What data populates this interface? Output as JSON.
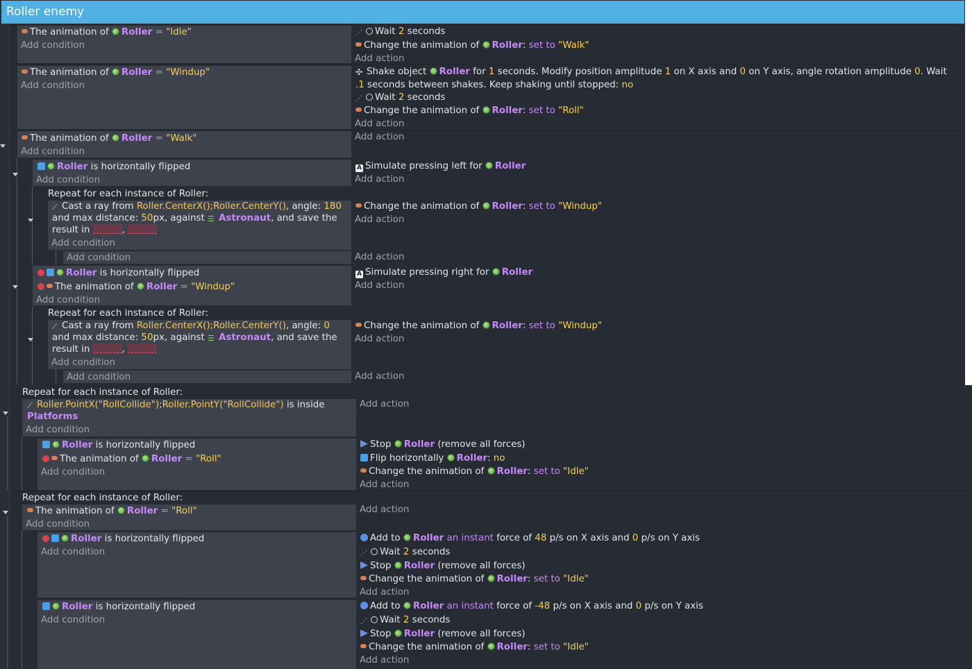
{
  "group": {
    "title": "Roller enemy"
  },
  "obj": "Roller",
  "astro": "Astronaut",
  "platforms": "Platforms",
  "add_condition": "Add condition",
  "add_action": "Add action",
  "words": {
    "anim_of": "The animation of",
    "eq": "=",
    "is_hflipped": "is horizontally flipped",
    "repeat": "Repeat for each instance of Roller:",
    "wait": "Wait",
    "seconds": "seconds",
    "change_anim": "Change the animation of",
    "set_to": "set to",
    "colon": ":",
    "stop": "Stop",
    "remove_forces": "(remove all forces)",
    "flip_h": "Flip horizontally",
    "no": "no",
    "add_to": "Add to",
    "instant": "an instant",
    "force_of": "force of",
    "ps_x": "p/s on X axis and",
    "ps_y": "p/s on Y axis",
    "sim_left": "Simulate pressing left for",
    "sim_right": "Simulate pressing right for",
    "is_inside": "is inside",
    "cast_ray": "Cast a ray from",
    "ray_expr": "Roller.CenterX();Roller.CenterY()",
    "angle": ", angle:",
    "and_max": "and max distance:",
    "and_max2": "and",
    "max_dist": "max distance:",
    "px_against": "px, against",
    "save_result": ", and save the result in",
    "save_the": ", and save the",
    "result_in": "result in",
    "comma": ",",
    "point_expr": "Roller.PointX(\"RollCollide\");Roller.PointY(\"RollCollide\")",
    "shake_obj": "Shake object",
    "shake_for": "for",
    "shake_mid": "seconds. Modify position amplitude",
    "shake_xy": "on X axis and",
    "shake_ang": "on Y axis, angle rotation amplitude",
    "shake_wait": ". Wait",
    "shake_end": "seconds between shakes. Keep shaking until stopped:"
  },
  "values": {
    "idle": "\"Idle\"",
    "windup": "\"Windup\"",
    "walk": "\"Walk\"",
    "roll": "\"Roll\"",
    "two": "2",
    "one": "1",
    "zero": "0",
    "dot_one": ".1",
    "angle180": "180",
    "angle0": "0",
    "dist50": "50",
    "f48": "48",
    "fneg48": "-48"
  },
  "colors": {
    "header": "#50b0e3",
    "bg": "#272b33",
    "block": "#3d424c",
    "keyword": "#c58af9",
    "number": "#f8d24b"
  },
  "icons": [
    "animation-icon",
    "roller-object-icon",
    "flip-icon",
    "wait-icon",
    "shake-icon",
    "keyboard-icon",
    "raycast-icon",
    "platform-icon",
    "invert-icon",
    "stop-icon",
    "force-icon"
  ]
}
